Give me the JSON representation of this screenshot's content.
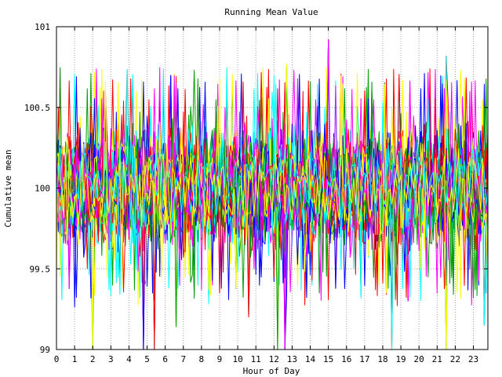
{
  "chart_data": {
    "type": "line",
    "title": "Running Mean Value",
    "xlabel": "Hour of Day",
    "ylabel": "Cumulative mean",
    "xlim": [
      0,
      23.8
    ],
    "ylim": [
      99,
      101
    ],
    "x_ticks": [
      "0",
      "1",
      "2",
      "3",
      "4",
      "5",
      "6",
      "7",
      "8",
      "9",
      "10",
      "11",
      "12",
      "13",
      "14",
      "15",
      "16",
      "17",
      "18",
      "19",
      "20",
      "21",
      "22",
      "23"
    ],
    "y_ticks": [
      "99",
      "99.5",
      "100",
      "100.5",
      "101"
    ],
    "grid": true,
    "legend": "none",
    "series_count": 60,
    "series_colors": [
      "#0000ff",
      "#ff0000",
      "#00a000",
      "#ff00ff",
      "#00ffff",
      "#ffff00"
    ],
    "typical_band": [
      99.7,
      100.3
    ],
    "notable_values": [
      {
        "x": 15.0,
        "y": 100.92
      },
      {
        "x": 21.5,
        "y": 100.82
      },
      {
        "x": 12.7,
        "y": 100.77
      },
      {
        "x": 6.3,
        "y": 100.7
      },
      {
        "x": 10.6,
        "y": 99.2
      },
      {
        "x": 6.6,
        "y": 99.14
      },
      {
        "x": 19.4,
        "y": 99.3
      },
      {
        "x": 23.6,
        "y": 99.15
      },
      {
        "x": 2.0,
        "y": 99.0
      },
      {
        "x": 4.8,
        "y": 99.0
      },
      {
        "x": 5.4,
        "y": 99.0
      },
      {
        "x": 12.2,
        "y": 99.0
      },
      {
        "x": 12.6,
        "y": 99.0
      },
      {
        "x": 18.5,
        "y": 99.0
      },
      {
        "x": 21.5,
        "y": 99.0
      }
    ]
  }
}
